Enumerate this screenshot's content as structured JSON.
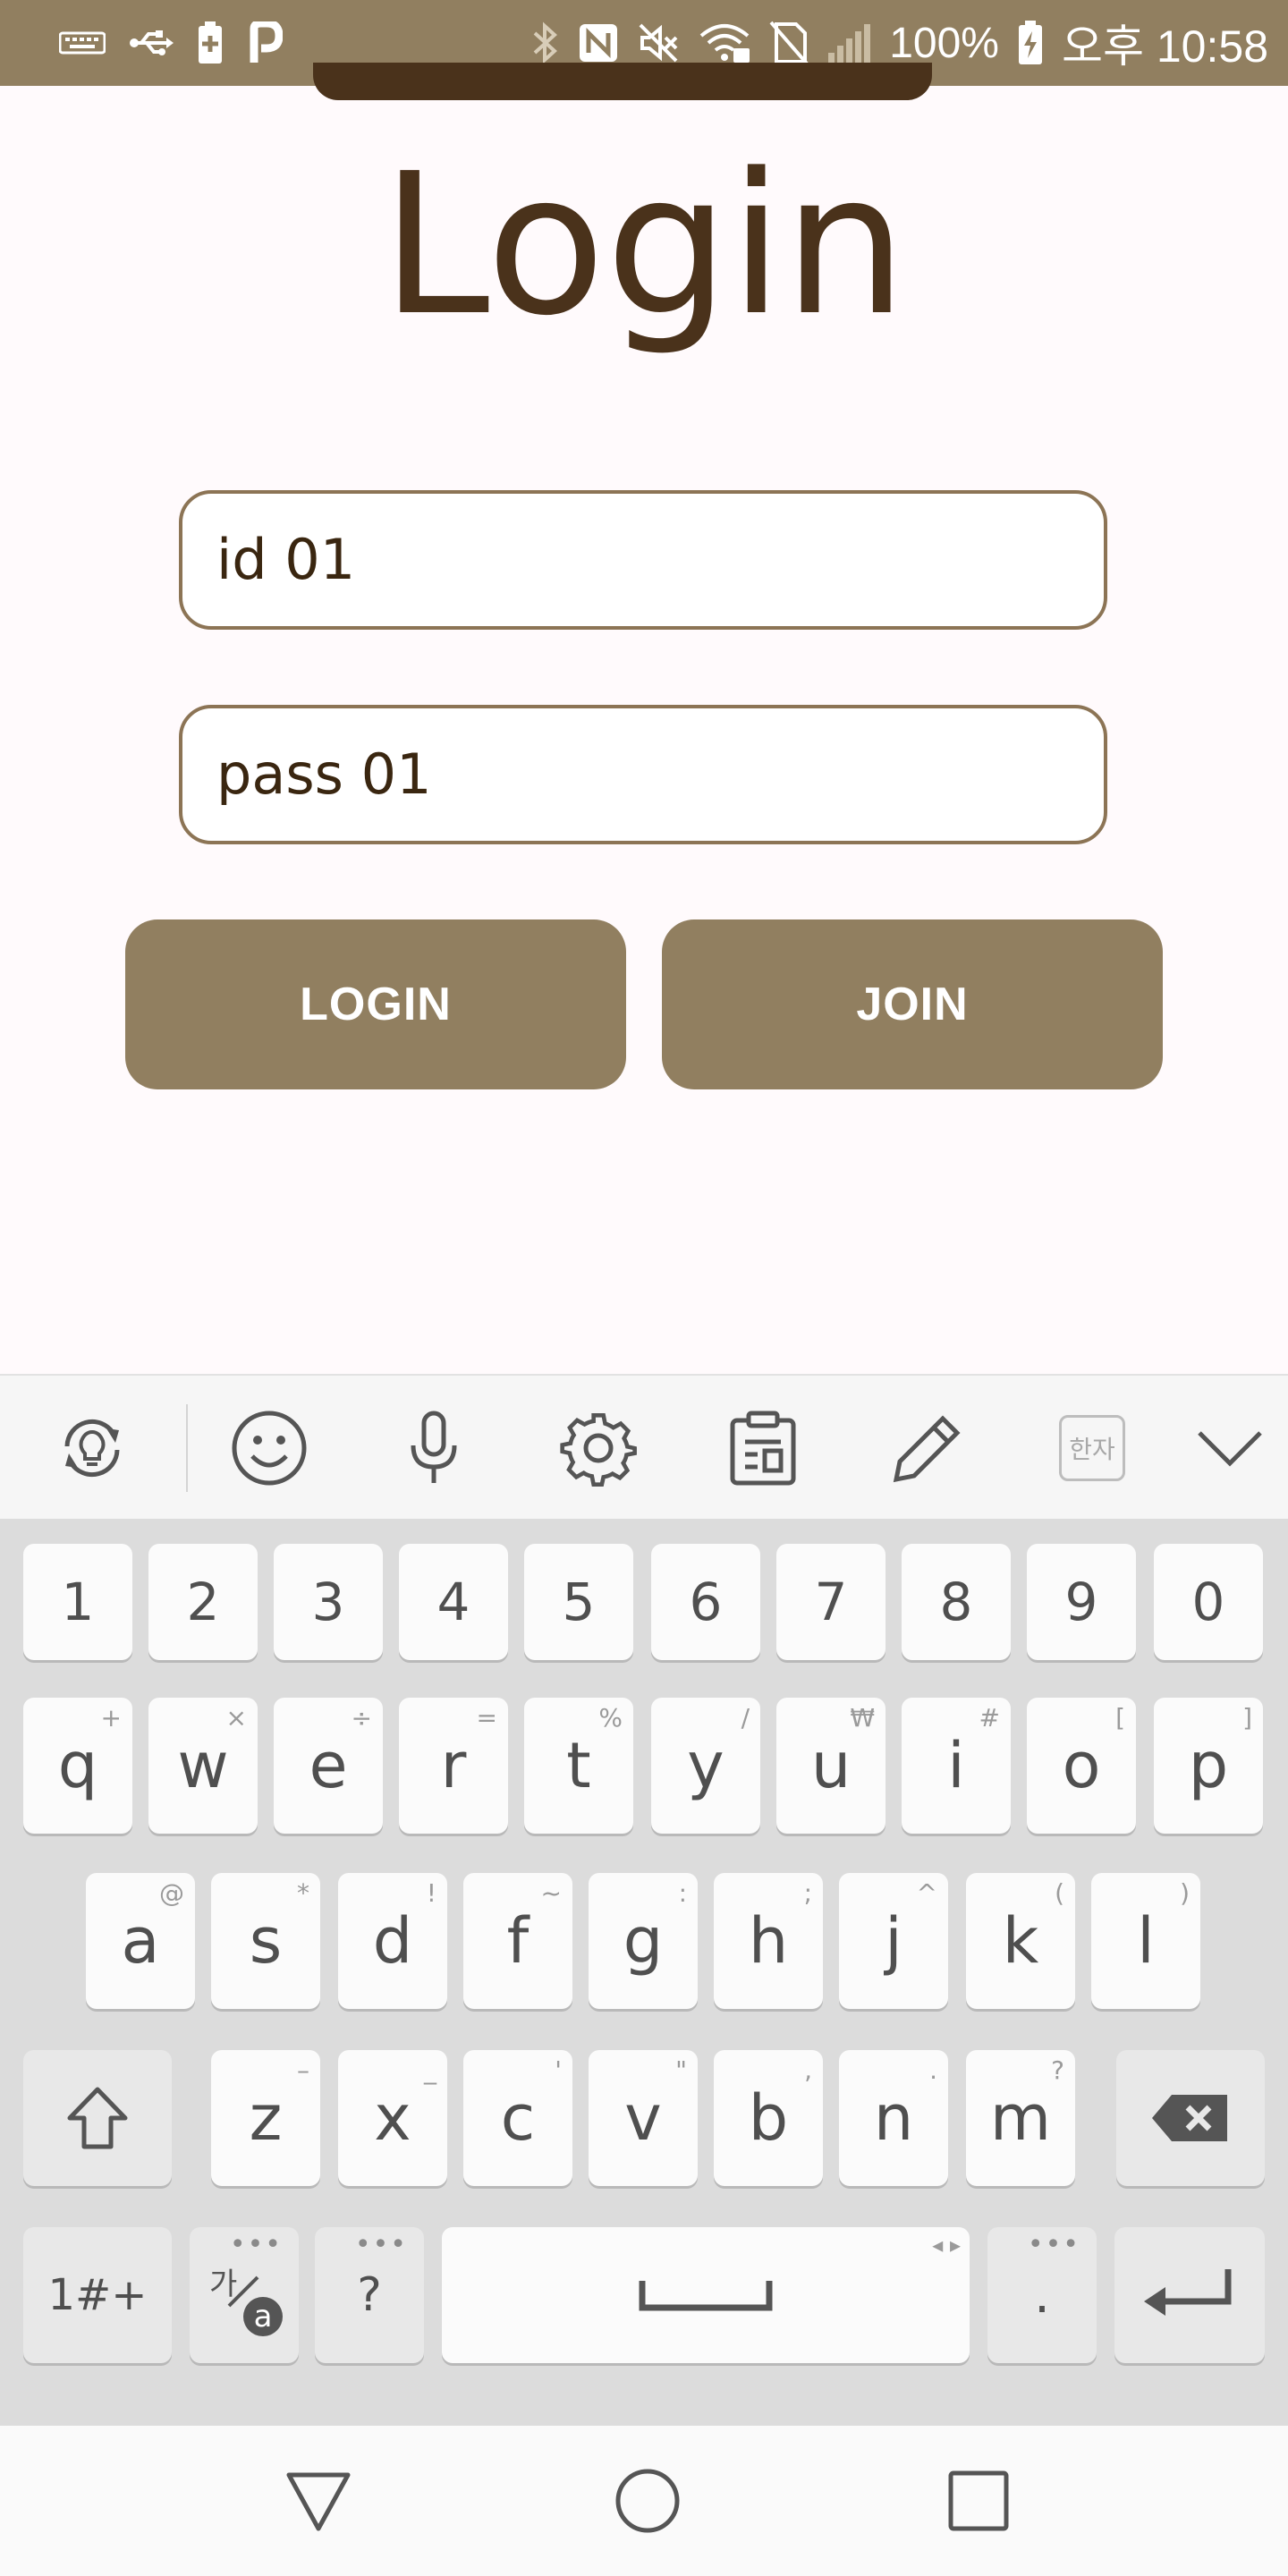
{
  "status_bar": {
    "battery_percent": "100%",
    "time": "오후 10:58",
    "left_icons": [
      "keyboard-icon",
      "usb-icon",
      "battery-saver-icon",
      "p-app-icon"
    ],
    "right_icons": [
      "bluetooth-icon",
      "nfc-icon",
      "mute-icon",
      "wifi-icon",
      "no-sim-icon",
      "signal-icon",
      "charging-battery-icon"
    ]
  },
  "login": {
    "title": "Login",
    "id_value": "id 01",
    "password_value": "pass 01",
    "login_label": "LOGIN",
    "join_label": "JOIN"
  },
  "keyboard_toolbar": {
    "icons": [
      "idea-refresh-icon",
      "emoji-icon",
      "microphone-icon",
      "settings-icon",
      "clipboard-icon",
      "pencil-icon",
      "hanja-icon",
      "collapse-icon"
    ],
    "hanja_label": "한자"
  },
  "keyboard": {
    "number_row": [
      "1",
      "2",
      "3",
      "4",
      "5",
      "6",
      "7",
      "8",
      "9",
      "0"
    ],
    "row1": [
      {
        "label": "q",
        "hint": "+"
      },
      {
        "label": "w",
        "hint": "×"
      },
      {
        "label": "e",
        "hint": "÷"
      },
      {
        "label": "r",
        "hint": "="
      },
      {
        "label": "t",
        "hint": "%"
      },
      {
        "label": "y",
        "hint": "/"
      },
      {
        "label": "u",
        "hint": "₩"
      },
      {
        "label": "i",
        "hint": "#"
      },
      {
        "label": "o",
        "hint": "["
      },
      {
        "label": "p",
        "hint": "]"
      }
    ],
    "row2": [
      {
        "label": "a",
        "hint": "@"
      },
      {
        "label": "s",
        "hint": "*"
      },
      {
        "label": "d",
        "hint": "!"
      },
      {
        "label": "f",
        "hint": "~"
      },
      {
        "label": "g",
        "hint": ":"
      },
      {
        "label": "h",
        "hint": ";"
      },
      {
        "label": "j",
        "hint": "^"
      },
      {
        "label": "k",
        "hint": "("
      },
      {
        "label": "l",
        "hint": ")"
      }
    ],
    "row3": [
      {
        "label": "z",
        "hint": "–"
      },
      {
        "label": "x",
        "hint": "_"
      },
      {
        "label": "c",
        "hint": "'"
      },
      {
        "label": "v",
        "hint": "\""
      },
      {
        "label": "b",
        "hint": ","
      },
      {
        "label": "n",
        "hint": "."
      },
      {
        "label": "m",
        "hint": "?"
      }
    ],
    "symbols_label": "1#+",
    "lang_label_top": "가",
    "lang_label_bottom": "a",
    "question_label": "?",
    "period_label": ".",
    "more_dots": "•••",
    "space_arrows": "◂ ▸"
  },
  "nav_bar": {
    "icons": [
      "back-icon",
      "home-icon",
      "recents-icon"
    ]
  },
  "colors": {
    "status_bar": "#917f60",
    "title_text": "#4a321b",
    "field_border": "#8c7455",
    "button_bg": "#917f60",
    "page_bg": "#fffafc",
    "keyboard_bg": "#dcdcdc"
  }
}
